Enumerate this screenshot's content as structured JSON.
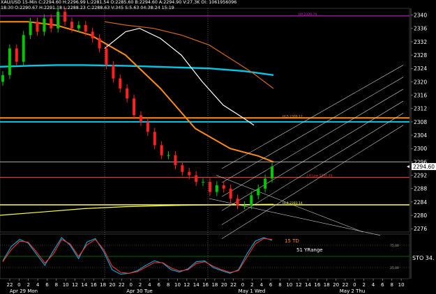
{
  "header": {
    "line1": "XAU/USD  15-Min  C:2294.60  H:2296.99  L:2281.54  O:2285.60  B:2294.60  A:2294.90  V:27.3K  OI: 1061956096",
    "line2": "18:30  O:2290.67  H:2291.18  L:2288.23  C:2288.63  V:345  S:5.63  04:38:24  15:19"
  },
  "colors": {
    "background": "#000000",
    "price_up": "#00c800",
    "price_down": "#ff2020",
    "sma_cyan": "#00c8e6",
    "orange": "#ff8c1a",
    "red_level": "#ff3333",
    "yellow": "#ffff40",
    "magenta": "#e020e0",
    "white": "#ffffff",
    "brown": "#d2691e",
    "channel": "#c8c8c8",
    "stoch_k": "#00b0e0",
    "stoch_d": "#ff3030"
  },
  "chart_data": [
    {
      "type": "line",
      "panel": "price",
      "instrument": "XAU/USD",
      "timeframe": "15-Min",
      "ylim": [
        2275,
        2342
      ],
      "y_ticks": [
        2276,
        2280,
        2284,
        2288,
        2292,
        2296,
        2300,
        2304,
        2308,
        2312,
        2316,
        2320,
        2324,
        2328,
        2332,
        2336,
        2340
      ],
      "x_ticks": [
        "22",
        "0",
        "2",
        "4",
        "6",
        "8",
        "10",
        "12",
        "14",
        "16",
        "18",
        "20",
        "22",
        "0",
        "2",
        "4",
        "6",
        "8",
        "10",
        "12",
        "14",
        "16",
        "18",
        "20",
        "22",
        "0",
        "2",
        "4",
        "6",
        "8",
        "10",
        "12",
        "14",
        "16",
        "18",
        "20",
        "22",
        "0",
        "2",
        "4",
        "6",
        "8",
        "10",
        "12"
      ],
      "day_labels": [
        "Apr 29 Mon",
        "Apr 30 Tue",
        "May 1 Wed",
        "May 2 Thu"
      ],
      "last_price_label": "2294.60",
      "close": [
        2322,
        2330,
        2326,
        2334,
        2338,
        2335,
        2339,
        2336,
        2341,
        2338,
        2336,
        2337,
        2335,
        2333,
        2330,
        2325,
        2321,
        2318,
        2315,
        2310,
        2308,
        2305,
        2301,
        2298,
        2298,
        2295,
        2293,
        2292,
        2290,
        2290,
        2287,
        2289,
        2288,
        2285,
        2283,
        2283,
        2286,
        2288,
        2291,
        2294.6
      ],
      "series": [
        {
          "name": "",
          "color": "#00c8e6",
          "values": [
            2324.5,
            2324.8,
            2325,
            2325,
            2324.8,
            2324.4,
            2324,
            2323.2,
            2322
          ]
        },
        {
          "name": "",
          "color": "#ff8c1a",
          "values": [
            2338,
            2338,
            2337,
            2334,
            2328,
            2318,
            2306,
            2300,
            2297.8,
            2296
          ]
        },
        {
          "name": "",
          "color": "#ffffff",
          "values": [
            2330,
            2335,
            2336,
            2333,
            2328,
            2320,
            2313,
            2309,
            2307
          ]
        },
        {
          "name": "",
          "color": "#d2691e",
          "values": [
            2338,
            2337,
            2336,
            2334,
            2331,
            2327,
            2323,
            2318
          ]
        },
        {
          "name": "",
          "color": "#ffff40",
          "values": [
            2280,
            2281,
            2282,
            2282.6,
            2283,
            2283.2,
            2283.3
          ]
        }
      ],
      "levels": [
        {
          "label": "HP  2339.74",
          "value": 2339.74,
          "color": "#e020e0"
        },
        {
          "label": "HLS  2309.17",
          "value": 2309.17,
          "color": "#ff8c1a"
        },
        {
          "label": "",
          "value": 2308.0,
          "color": "#00c8e6"
        },
        {
          "label": "",
          "value": 2296.0,
          "color": "#aaaaaa"
        },
        {
          "label": "LH Low  2291.39",
          "value": 2291.39,
          "color": "#ff3333"
        },
        {
          "label": "HL4  2283.14",
          "value": 2283.14,
          "color": "#ffff40"
        }
      ]
    },
    {
      "type": "line",
      "panel": "stochastic",
      "ylim": [
        0,
        100
      ],
      "y_ticks": [
        "75.00",
        "25.00"
      ],
      "labels": [
        "15 TD",
        "51 YRange",
        "STO  34."
      ],
      "series": [
        {
          "name": "",
          "color": "#00b0e0",
          "values": [
            40,
            72,
            88,
            80,
            55,
            30,
            62,
            92,
            75,
            45,
            82,
            90,
            60,
            20,
            10,
            12,
            18,
            30,
            40,
            35,
            20,
            15,
            22,
            38,
            40,
            25,
            18,
            12,
            20,
            55,
            84,
            92,
            86
          ]
        },
        {
          "name": "",
          "color": "#ff3030",
          "values": [
            38,
            65,
            84,
            82,
            60,
            35,
            55,
            88,
            78,
            50,
            76,
            88,
            65,
            28,
            14,
            12,
            16,
            26,
            36,
            36,
            24,
            17,
            20,
            34,
            38,
            28,
            20,
            14,
            18,
            48,
            78,
            90,
            88
          ]
        }
      ]
    }
  ]
}
